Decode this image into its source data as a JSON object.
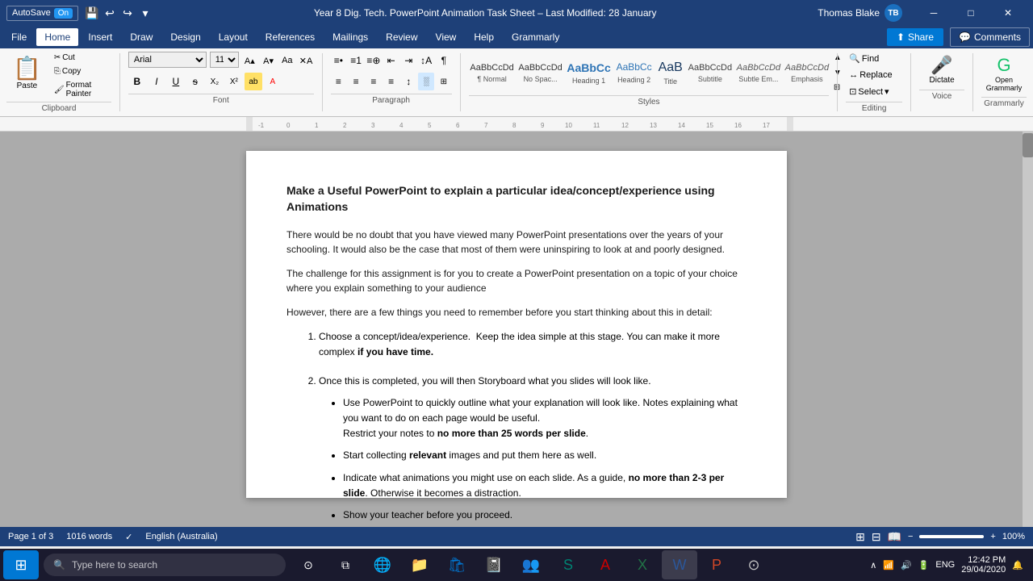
{
  "titlebar": {
    "autosave": "AutoSave",
    "autosave_state": "On",
    "doc_title": "Year 8 Dig. Tech. PowerPoint Animation Task Sheet – Last Modified: 28 January",
    "user_name": "Thomas Blake",
    "user_initials": "TB",
    "save_icon": "💾",
    "undo_icon": "↩",
    "redo_icon": "↪"
  },
  "menu": {
    "items": [
      "File",
      "Home",
      "Insert",
      "Draw",
      "Design",
      "Layout",
      "References",
      "Mailings",
      "Review",
      "View",
      "Help",
      "Grammarly"
    ],
    "active": "Home"
  },
  "ribbon": {
    "clipboard": {
      "paste": "Paste",
      "cut": "Cut",
      "copy": "Copy",
      "format_painter": "Format Painter",
      "label": "Clipboard"
    },
    "font": {
      "face": "Arial",
      "size": "11",
      "bold": "B",
      "italic": "I",
      "underline": "U",
      "strikethrough": "S",
      "label": "Font"
    },
    "paragraph": {
      "label": "Paragraph"
    },
    "styles": {
      "items": [
        {
          "name": "Normal",
          "preview": "AaBbCcDd",
          "key": "normal"
        },
        {
          "name": "No Spac...",
          "preview": "AaBbCcDd",
          "key": "no-space"
        },
        {
          "name": "Heading 1",
          "preview": "AaBbCc",
          "key": "heading1"
        },
        {
          "name": "Heading 2",
          "preview": "AaBbCc",
          "key": "heading2"
        },
        {
          "name": "Title",
          "preview": "AaB",
          "key": "title"
        },
        {
          "name": "Subtitle",
          "preview": "AaBbCcDd",
          "key": "subtitle"
        },
        {
          "name": "Subtle Em...",
          "preview": "AaBbCcDd",
          "key": "subtle"
        },
        {
          "name": "Emphasis",
          "preview": "AaBbCcDd",
          "key": "emphasis"
        }
      ],
      "label": "Styles"
    },
    "editing": {
      "find": "Find",
      "replace": "Replace",
      "select": "Select",
      "label": "Editing"
    },
    "voice": {
      "dictate": "Dictate",
      "label": "Voice"
    },
    "grammarly": {
      "label": "Grammarly"
    },
    "share": "Share",
    "comments": "Comments"
  },
  "document": {
    "heading": "Make a Useful PowerPoint to explain a particular idea/concept/experience using Animations",
    "para1": "There would be no doubt that you have viewed many PowerPoint presentations over the years of your schooling. It would also be the case that most of them were uninspiring to look at and poorly designed.",
    "para2": "The challenge for this assignment is for you to create a PowerPoint presentation on a topic of your choice where you explain something to your audience",
    "para3": "However, there are a few things you need to remember before you start thinking about this in detail:",
    "ordered_items": [
      {
        "num": "1.",
        "text_before": "Choose a concept/idea/experience.  Keep the idea simple at this stage. You can make it more complex ",
        "bold": "if you have time.",
        "text_after": ""
      },
      {
        "num": "2.",
        "text_before": "Once this is completed, you will then Storyboard what you slides will look like.",
        "bold": "",
        "text_after": ""
      }
    ],
    "bullet_items": [
      {
        "text_before": "Use PowerPoint to quickly outline what your explanation will look like. Notes explaining what you want to do on each page would be useful.\nRestrict your notes to ",
        "bold": "no more than 25 words per slide",
        "text_after": "."
      },
      {
        "text_before": "Start collecting ",
        "bold": "relevant",
        "text_after": " images and put them here as well."
      },
      {
        "text_before": "Indicate what animations you might use on each slide. As a guide, ",
        "bold": "no more than 2-3 per slide",
        "text_after": ". Otherwise it becomes a distraction."
      },
      {
        "text_before": "Show your teacher before you proceed.",
        "bold": "",
        "text_after": ""
      }
    ]
  },
  "statusbar": {
    "page": "Page 1 of 3",
    "words": "1016 words",
    "language": "English (Australia)",
    "zoom": "100%"
  },
  "taskbar": {
    "search_placeholder": "Type here to search",
    "time": "12:42 PM",
    "date": "29/04/2020",
    "lang": "ENG"
  }
}
